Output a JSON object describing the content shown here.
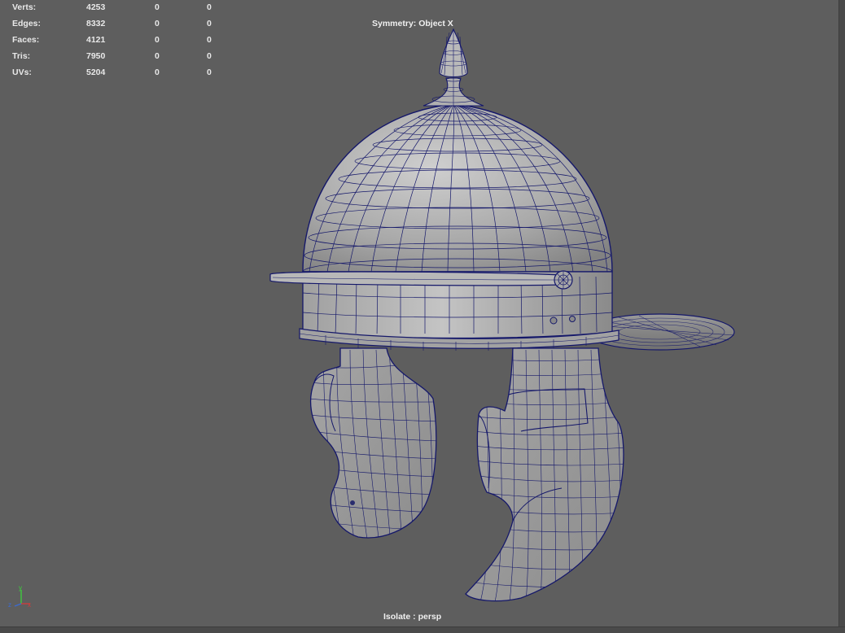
{
  "hud": {
    "stats": [
      {
        "label": "Verts:",
        "total": "4253",
        "selected": "0",
        "highlighted": "0"
      },
      {
        "label": "Edges:",
        "total": "8332",
        "selected": "0",
        "highlighted": "0"
      },
      {
        "label": "Faces:",
        "total": "4121",
        "selected": "0",
        "highlighted": "0"
      },
      {
        "label": "Tris:",
        "total": "7950",
        "selected": "0",
        "highlighted": "0"
      },
      {
        "label": "UVs:",
        "total": "5204",
        "selected": "0",
        "highlighted": "0"
      }
    ],
    "symmetry": "Symmetry: Object X",
    "camera": "Isolate : persp"
  },
  "axis": {
    "y": "y",
    "x": "x",
    "z": "z"
  },
  "colors": {
    "background": "#5e5e5e",
    "wire": "#15186a",
    "shaded_light": "#c8c8c8",
    "shaded_dark": "#7a7a7a",
    "axis_x": "#d33b3b",
    "axis_y": "#3bd33b",
    "axis_z": "#3b6bd3"
  }
}
